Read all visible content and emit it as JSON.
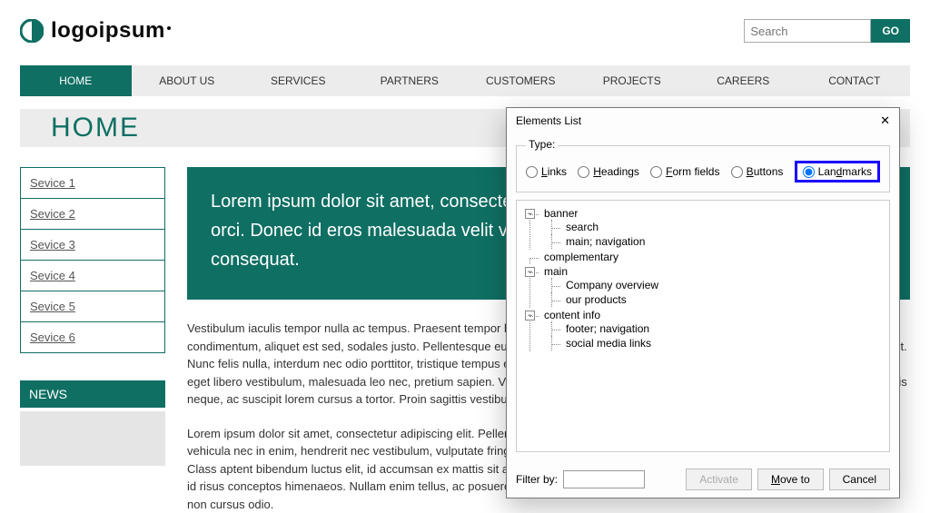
{
  "header": {
    "logo_text": "logoipsum",
    "search_placeholder": "Search",
    "go_label": "GO"
  },
  "nav": {
    "items": [
      {
        "label": "HOME",
        "active": true
      },
      {
        "label": "ABOUT US",
        "active": false
      },
      {
        "label": "SERVICES",
        "active": false
      },
      {
        "label": "PARTNERS",
        "active": false
      },
      {
        "label": "CUSTOMERS",
        "active": false
      },
      {
        "label": "PROJECTS",
        "active": false
      },
      {
        "label": "CAREERS",
        "active": false
      },
      {
        "label": "CONTACT",
        "active": false
      }
    ]
  },
  "title": "HOME",
  "sidebar": {
    "items": [
      {
        "label": "Sevice 1"
      },
      {
        "label": "Sevice 2"
      },
      {
        "label": "Sevice 3"
      },
      {
        "label": "Sevice 4"
      },
      {
        "label": "Sevice 5"
      },
      {
        "label": "Sevice 6"
      }
    ],
    "news_label": "NEWS"
  },
  "hero_text": "Lorem ipsum dolor sit amet, consectetur adipiscing elit. Vestibulum vitae pulvinar orci. Donec id eros malesuada velit volutpat pretium. Quisque tincidunt, tortor sed consequat.",
  "para1": "Vestibulum iaculis tempor nulla ac tempus. Praesent tempor leo dolor. Aliquam vel nibh vitae libero pretium bibendum ut ac urna condimentum, aliquet est sed, sodales justo. Pellentesque eu consectetur est. Sed ut blandit lorem. Sed a metus sit amet enim gravida ut. Nunc felis nulla, interdum nec odio porttitor, tristique tempus elit. Praesent dapibus sapien elit, vel ullamcorper augue fermentum. Nulla eget libero vestibulum, malesuada leo nec, pretium sapien. Vestibulum tincidunt pellentesque felis et aliquam. Suspendisse nunc convallis neque, ac suscipit lorem cursus a tortor. Proin sagittis vestibulum urna, a eleifend dolor sollicitudin.",
  "para2": "Lorem ipsum dolor sit amet, consectetur adipiscing elit. Pellentesque id aliquam diam, non condimentum nisi. In et ante at elit dignissim vehicula nec in enim, hendrerit nec vestibulum, vulputate fringilla justo. Sed tristique tellus in ex rhoncus, id sollicitudin augue ultricies. Class aptent bibendum luctus elit, id accumsan ex mattis sit amet. Class aptenti sociosqu ad litora torquent per conubia nostra. Praesent id risus conceptos himenaeos. Nullam enim tellus, ac posuere leo feugiat volutpat enim. Sed sagittis, libero quis sollicitudin pellentesque non cursus odio.",
  "dialog": {
    "title": "Elements List",
    "type_label": "Type:",
    "radios": {
      "links": "Links",
      "headings": "Headings",
      "form_fields": "Form fields",
      "buttons": "Buttons",
      "landmarks": "Landmarks"
    },
    "tree": [
      {
        "label": "banner",
        "exp": "-",
        "children": [
          {
            "label": "search"
          },
          {
            "label": "main; navigation"
          }
        ]
      },
      {
        "label": "complementary"
      },
      {
        "label": "main",
        "exp": "-",
        "children": [
          {
            "label": "Company overview"
          },
          {
            "label": "our products"
          }
        ]
      },
      {
        "label": "content info",
        "exp": "-",
        "children": [
          {
            "label": "footer; navigation"
          },
          {
            "label": "social media links"
          }
        ]
      }
    ],
    "filter_label": "Filter by:",
    "buttons": {
      "activate": "Activate",
      "moveto": "Move to",
      "cancel": "Cancel"
    }
  }
}
